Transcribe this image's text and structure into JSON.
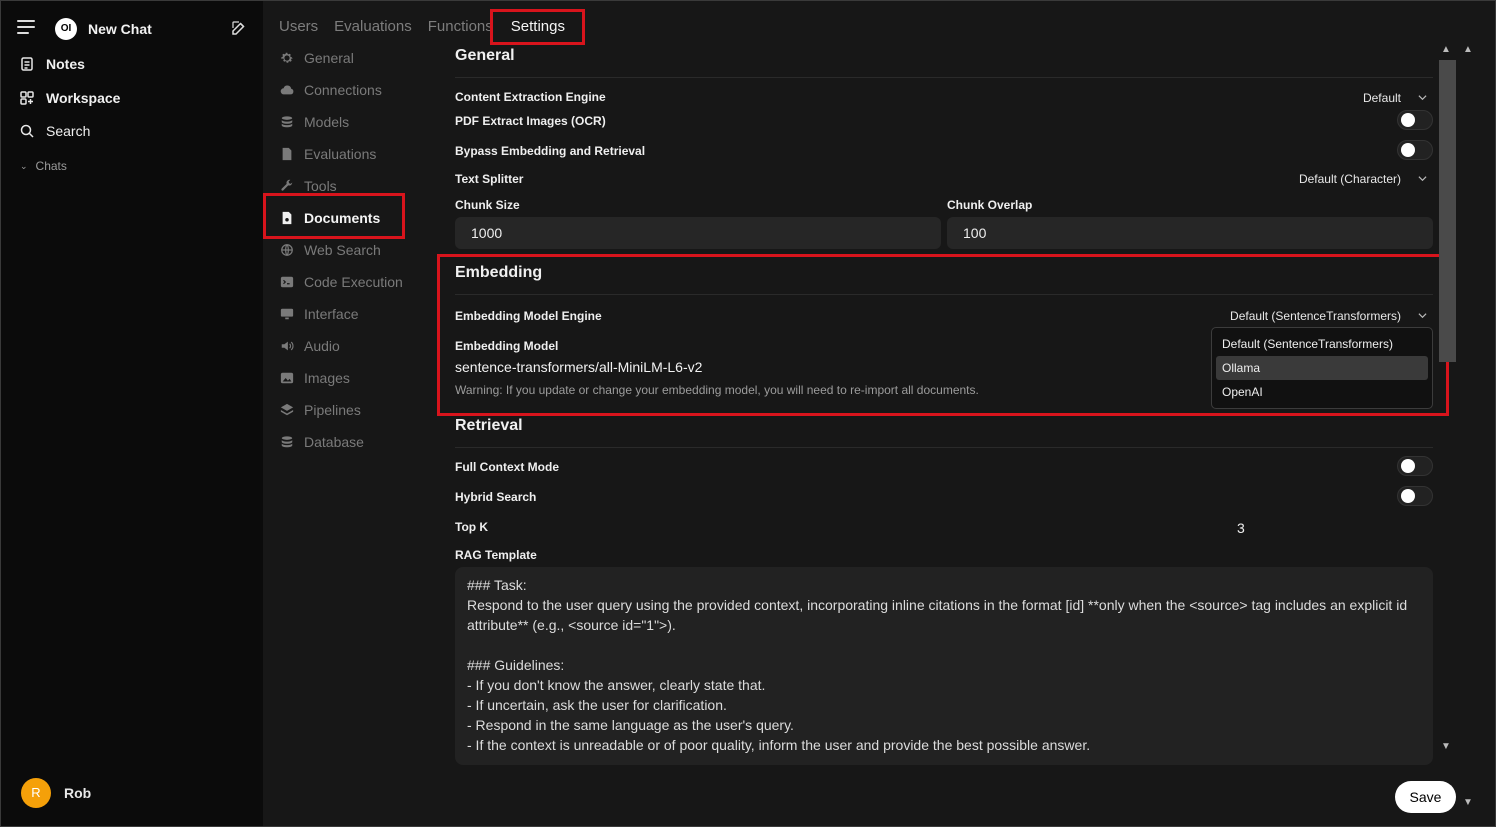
{
  "sidebar": {
    "new_chat": "New Chat",
    "items": [
      {
        "label": "Notes",
        "icon": "notes-icon"
      },
      {
        "label": "Workspace",
        "icon": "workspace-icon"
      },
      {
        "label": "Search",
        "icon": "search-icon"
      }
    ],
    "chats_label": "Chats",
    "user": {
      "initial": "R",
      "name": "Rob",
      "avatar_color": "#f5a009"
    }
  },
  "tabs": [
    "Users",
    "Evaluations",
    "Functions",
    "Settings"
  ],
  "active_tab": "Settings",
  "settings_nav": [
    {
      "label": "General",
      "icon": "gear-icon"
    },
    {
      "label": "Connections",
      "icon": "cloud-icon"
    },
    {
      "label": "Models",
      "icon": "stack-icon"
    },
    {
      "label": "Evaluations",
      "icon": "document-icon"
    },
    {
      "label": "Tools",
      "icon": "wrench-icon"
    },
    {
      "label": "Documents",
      "icon": "file-icon"
    },
    {
      "label": "Web Search",
      "icon": "globe-icon"
    },
    {
      "label": "Code Execution",
      "icon": "terminal-icon"
    },
    {
      "label": "Interface",
      "icon": "monitor-icon"
    },
    {
      "label": "Audio",
      "icon": "speaker-icon"
    },
    {
      "label": "Images",
      "icon": "image-icon"
    },
    {
      "label": "Pipelines",
      "icon": "layers-icon"
    },
    {
      "label": "Database",
      "icon": "database-icon"
    }
  ],
  "active_nav": "Documents",
  "general": {
    "title": "General",
    "content_extraction_label": "Content Extraction Engine",
    "content_extraction_value": "Default",
    "pdf_ocr_label": "PDF Extract Images (OCR)",
    "bypass_label": "Bypass Embedding and Retrieval",
    "text_splitter_label": "Text Splitter",
    "text_splitter_value": "Default (Character)",
    "chunk_size_label": "Chunk Size",
    "chunk_size_value": "1000",
    "chunk_overlap_label": "Chunk Overlap",
    "chunk_overlap_value": "100"
  },
  "embedding": {
    "title": "Embedding",
    "engine_label": "Embedding Model Engine",
    "engine_value": "Default (SentenceTransformers)",
    "engine_options": [
      "Default (SentenceTransformers)",
      "Ollama",
      "OpenAI"
    ],
    "highlighted_option": "Ollama",
    "model_label": "Embedding Model",
    "model_value": "sentence-transformers/all-MiniLM-L6-v2",
    "warning": "Warning: If you update or change your embedding model, you will need to re-import all documents."
  },
  "retrieval": {
    "title": "Retrieval",
    "full_context_label": "Full Context Mode",
    "hybrid_label": "Hybrid Search",
    "top_k_label": "Top K",
    "top_k_value": "3",
    "rag_label": "RAG Template",
    "rag_text": "### Task:\nRespond to the user query using the provided context, incorporating inline citations in the format [id] **only when the <source> tag includes an explicit id attribute** (e.g., <source id=\"1\">).\n\n### Guidelines:\n- If you don't know the answer, clearly state that.\n- If uncertain, ask the user for clarification.\n- Respond in the same language as the user's query.\n- If the context is unreadable or of poor quality, inform the user and provide the best possible answer."
  },
  "save_label": "Save",
  "highlight_color": "#d8141c"
}
